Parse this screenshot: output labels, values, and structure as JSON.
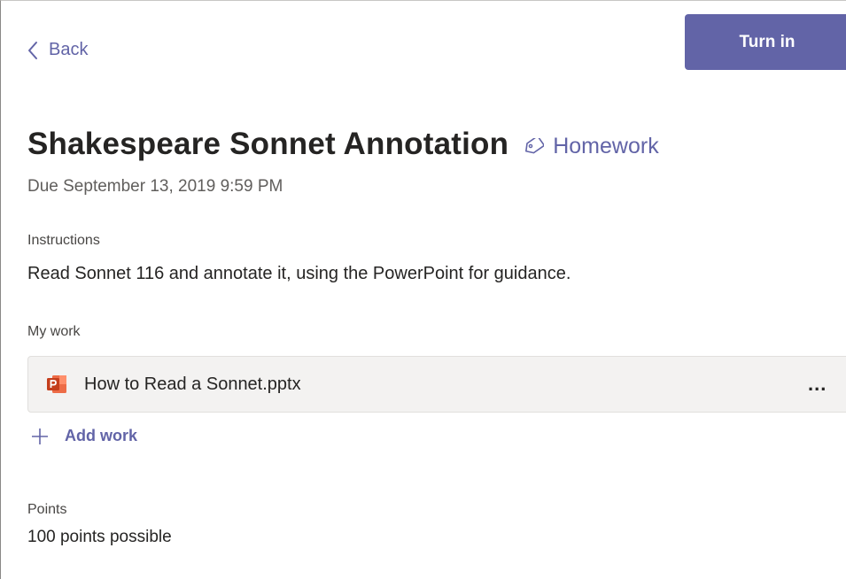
{
  "header": {
    "back_label": "Back",
    "turn_in_label": "Turn in"
  },
  "assignment": {
    "title": "Shakespeare Sonnet Annotation",
    "category": "Homework",
    "due": "Due September 13, 2019 9:59 PM"
  },
  "instructions": {
    "label": "Instructions",
    "text": "Read Sonnet 116 and annotate it, using the PowerPoint for guidance."
  },
  "my_work": {
    "label": "My work",
    "files": [
      {
        "name": "How to Read a Sonnet.pptx",
        "icon": "powerpoint-icon",
        "menu": "..."
      }
    ],
    "add_label": "Add work"
  },
  "points": {
    "label": "Points",
    "value": "100 points possible"
  },
  "colors": {
    "accent": "#6264a7",
    "powerpoint": "#c43e1c",
    "file_row_bg": "#f3f2f1"
  }
}
